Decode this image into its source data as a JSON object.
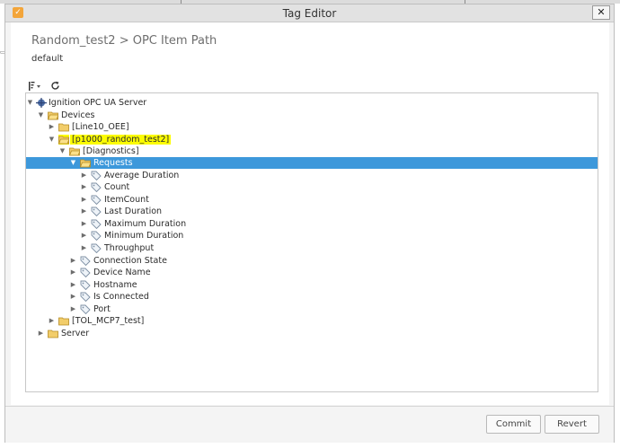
{
  "window": {
    "title": "Tag Editor",
    "app_icon": "ignition-app-icon",
    "close_label": "✕"
  },
  "header": {
    "breadcrumb": "Random_test2 > OPC Item Path",
    "provider": "default"
  },
  "toolbar": {
    "sort_icon": "sort-icon",
    "refresh_icon": "refresh-icon"
  },
  "tree": {
    "root": "Ignition OPC UA Server",
    "devices": "Devices",
    "line10": "[Line10_OEE]",
    "p1000": "[p1000_random_test2]",
    "diagnostics": "[Diagnostics]",
    "requests": "Requests",
    "avg_duration": "Average Duration",
    "count": "Count",
    "item_count": "ItemCount",
    "last_duration": "Last Duration",
    "max_duration": "Maximum Duration",
    "min_duration": "Minimum Duration",
    "throughput": "Throughput",
    "connection_state": "Connection State",
    "device_name": "Device Name",
    "hostname": "Hostname",
    "is_connected": "Is Connected",
    "port": "Port",
    "tol": "[TOL_MCP7_test]",
    "server": "Server",
    "highlight_color": "#fcfc00",
    "selection_color": "#3d98db"
  },
  "footer": {
    "commit_label": "Commit",
    "revert_label": "Revert"
  }
}
